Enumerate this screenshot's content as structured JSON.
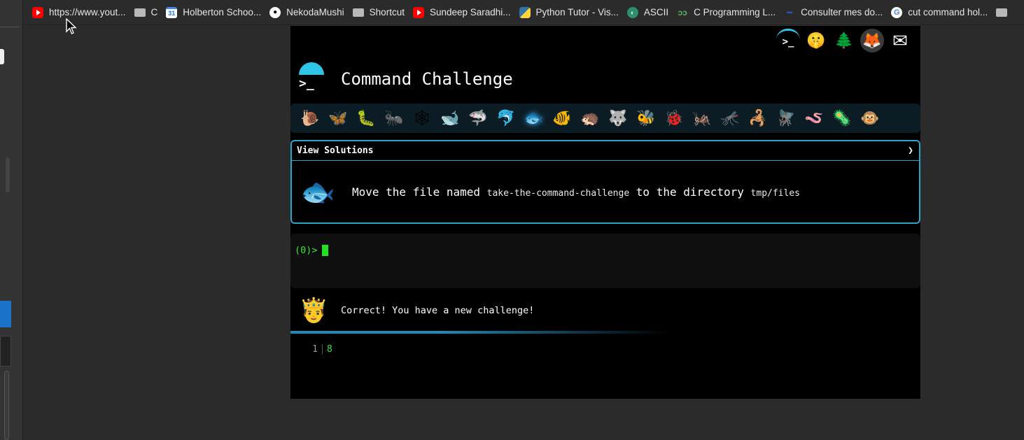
{
  "bookmarks": [
    {
      "icon": "youtube-icon",
      "label": "https://www.yout..."
    },
    {
      "icon": "folder-icon",
      "label": "C"
    },
    {
      "icon": "calendar-icon",
      "icon_text": "31",
      "label": "Holberton Schoo..."
    },
    {
      "icon": "github-icon",
      "label": "NekodaMushi"
    },
    {
      "icon": "folder-icon",
      "label": "Shortcut"
    },
    {
      "icon": "youtube-icon",
      "label": "Sundeep Saradhi..."
    },
    {
      "icon": "python-icon",
      "label": "Python Tutor - Vis..."
    },
    {
      "icon": "ascii-icon",
      "label": "ASCII"
    },
    {
      "icon": "c-programming-icon",
      "label": "C Programming L..."
    },
    {
      "icon": "consulter-icon",
      "label": "Consulter mes do..."
    },
    {
      "icon": "google-icon",
      "icon_text": "G",
      "label": "cut command hol..."
    },
    {
      "icon": "folder-icon",
      "label": ""
    }
  ],
  "header": {
    "title": "Command Challenge",
    "logo_prompt": ">_",
    "top_icons": [
      {
        "name": "terminal-logo-icon",
        "glyph": ">_"
      },
      {
        "name": "shush-face-icon",
        "glyph": "🤫"
      },
      {
        "name": "tree-icon",
        "glyph": "🌲"
      },
      {
        "name": "gitlab-icon",
        "glyph": "🦊"
      },
      {
        "name": "envelope-icon",
        "glyph": "✉"
      }
    ]
  },
  "levels": [
    {
      "name": "snail-icon",
      "glyph": "🐌"
    },
    {
      "name": "butterfly-icon",
      "glyph": "🦋"
    },
    {
      "name": "caterpillar-icon",
      "glyph": "🐛"
    },
    {
      "name": "ant-icon",
      "glyph": "🐜"
    },
    {
      "name": "spider-web-icon",
      "glyph": "🕸"
    },
    {
      "name": "whale-icon",
      "glyph": "🐋"
    },
    {
      "name": "shark-icon",
      "glyph": "🦈"
    },
    {
      "name": "dolphin-icon",
      "glyph": "🐬"
    },
    {
      "name": "fish-icon",
      "glyph": "🐟",
      "active": true
    },
    {
      "name": "tropical-fish-icon",
      "glyph": "🐠"
    },
    {
      "name": "hedgehog-icon",
      "glyph": "🦔"
    },
    {
      "name": "wolf-icon",
      "glyph": "🐺"
    },
    {
      "name": "bee-icon",
      "glyph": "🐝"
    },
    {
      "name": "ladybug-icon",
      "glyph": "🐞"
    },
    {
      "name": "cricket-icon",
      "glyph": "🦗"
    },
    {
      "name": "mosquito-icon",
      "glyph": "🦟"
    },
    {
      "name": "scorpion-icon",
      "glyph": "🦂"
    },
    {
      "name": "fly-icon",
      "glyph": "🪰"
    },
    {
      "name": "worm-icon",
      "glyph": "🪱"
    },
    {
      "name": "microbe-icon",
      "glyph": "🦠"
    },
    {
      "name": "monkey-icon",
      "glyph": "🐵"
    }
  ],
  "solutions": {
    "label": "View Solutions",
    "chevron": "❯",
    "challenge_icon": "🐟",
    "task_text_1": "Move the file named ",
    "task_code_1": "take-the-command-challenge",
    "task_text_2": " to the directory ",
    "task_code_2": "tmp/files"
  },
  "terminal": {
    "prompt": "(0)>"
  },
  "result": {
    "icon": "🤴",
    "message": "Correct! You have a new challenge!"
  },
  "progress": {
    "fraction": 0.6
  },
  "output": {
    "line_number": "1",
    "value": "8"
  }
}
